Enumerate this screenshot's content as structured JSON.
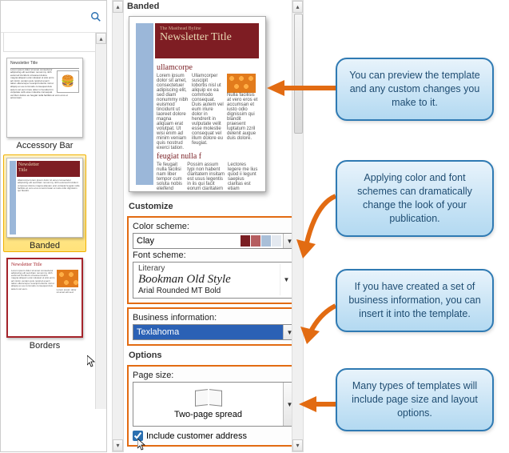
{
  "gallery": {
    "items": [
      {
        "label": "Accessory Bar"
      },
      {
        "label": "Banded"
      },
      {
        "label": "Borders"
      }
    ]
  },
  "preview": {
    "section_title": "Banded",
    "newsletter_title": "Newsletter Title",
    "subhead1": "ullamcorpe",
    "subhead2": "feugiat nulla f"
  },
  "customize": {
    "title": "Customize",
    "color_label": "Color scheme:",
    "color_value": "Clay",
    "swatches": [
      "#7a1e23",
      "#b55d60",
      "#a9bfd8",
      "#e4e9f0"
    ],
    "font_label": "Font scheme:",
    "font_caption": "Literary",
    "font_primary": "Bookman Old Style",
    "font_secondary": "Arial Rounded MT Bold",
    "biz_label": "Business information:",
    "biz_value": "Texlahoma"
  },
  "options": {
    "title": "Options",
    "page_label": "Page size:",
    "page_value": "Two-page spread",
    "include_label": "Include customer address",
    "include_checked": true
  },
  "callouts": {
    "c1": "You can preview the template and any custom changes you make to it.",
    "c2": "Applying color and font schemes can dramatically change the look of your publication.",
    "c3": "If you have created a set of business information, you can insert it into the template.",
    "c4": "Many types of templates will include page size and layout options."
  }
}
